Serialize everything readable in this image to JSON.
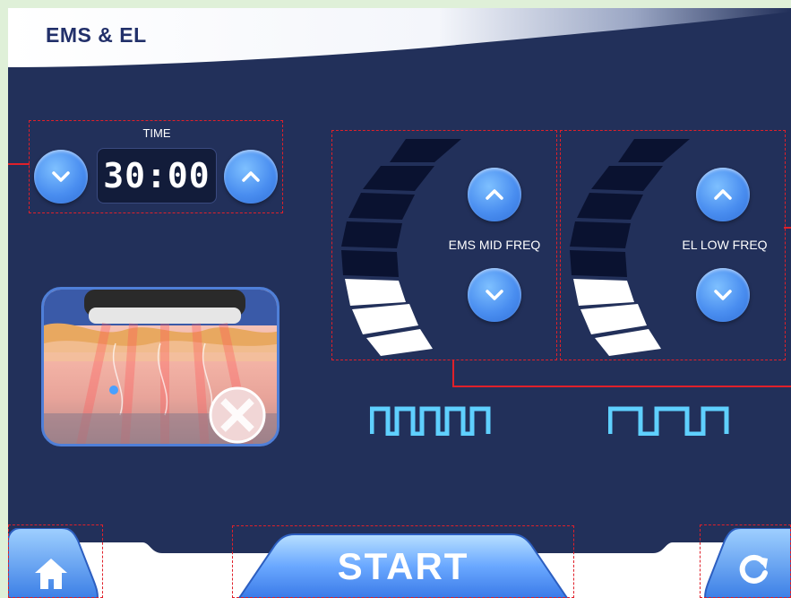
{
  "header": {
    "title": "EMS & EL"
  },
  "timer": {
    "label": "TIME",
    "value": "30:00"
  },
  "channels": [
    {
      "label": "EMS MID FREQ"
    },
    {
      "label": "EL LOW FREQ"
    }
  ],
  "footer": {
    "start_label": "START"
  },
  "colors": {
    "background": "#22305a",
    "accent_blue": "#4a8ef0",
    "annotation_red": "#e0202a",
    "wave_cyan": "#5fd0ff"
  }
}
